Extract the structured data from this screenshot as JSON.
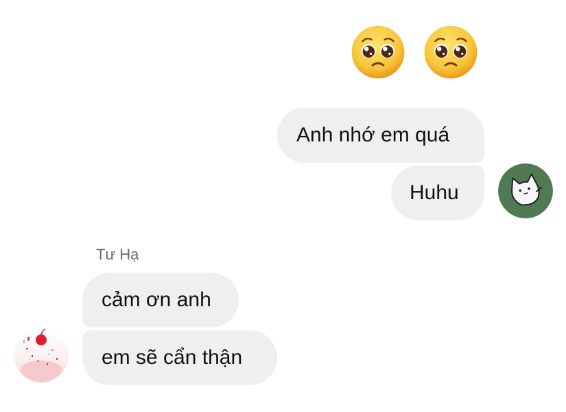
{
  "reactions": {
    "emoji_1": "pleading-face-emoji",
    "emoji_2": "pleading-face-emoji"
  },
  "messages": {
    "sent": [
      {
        "text": "Anh nhớ em quá"
      },
      {
        "text": "Huhu"
      }
    ],
    "received_sender": "Tư Hạ",
    "received": [
      {
        "text": "cảm ơn anh"
      },
      {
        "text": "em sẽ cẩn thận"
      }
    ]
  },
  "colors": {
    "bubble": "#efefef",
    "me_avatar_bg": "#4f7a52",
    "sender_name": "#6b6b6b"
  }
}
